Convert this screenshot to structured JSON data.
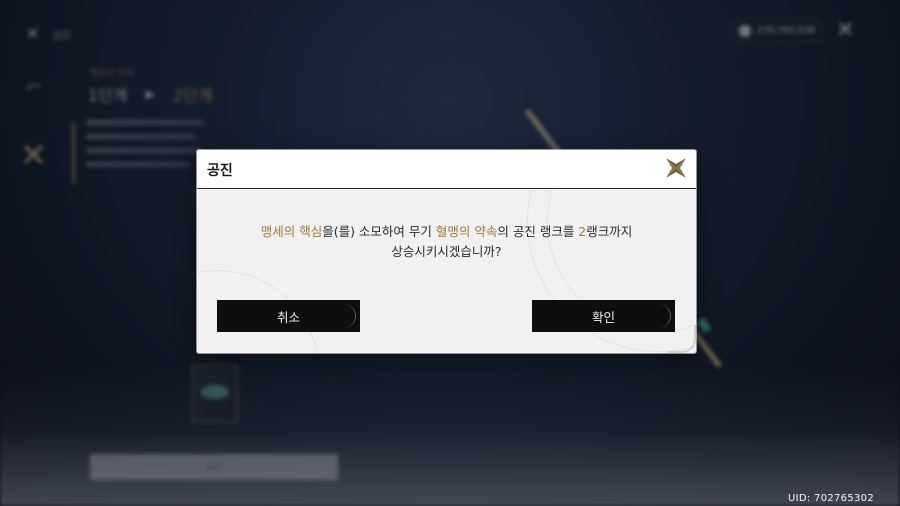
{
  "background": {
    "top_left_label": "설정",
    "currency_text": "235,760,638",
    "rank_title": "혈맹의 약속",
    "rank_from": "1단계",
    "rank_arrow": "▶",
    "rank_to": "2단계",
    "bottom_button_label": "공진"
  },
  "dialog": {
    "title": "공진",
    "message_parts": {
      "material": "맹세의 핵심",
      "part1": "을(를) 소모하여 무기 ",
      "weapon": "혈맹의 약속",
      "part2": "의 공진 랭크를 ",
      "rank": "2",
      "part3": "랭크까지",
      "line2": "상승시키시겠습니까?"
    },
    "cancel_label": "취소",
    "confirm_label": "확인"
  },
  "uid_label": "UID: 702765302",
  "icons": {
    "dialog_close": "star-close-icon",
    "top_right_close": "star-close-icon",
    "top_left_menu": "star-menu-icon"
  },
  "colors": {
    "highlight_gold": "#9c7a3a",
    "button_dark": "#0e0e0e",
    "dialog_bg": "#f1f1f1"
  }
}
